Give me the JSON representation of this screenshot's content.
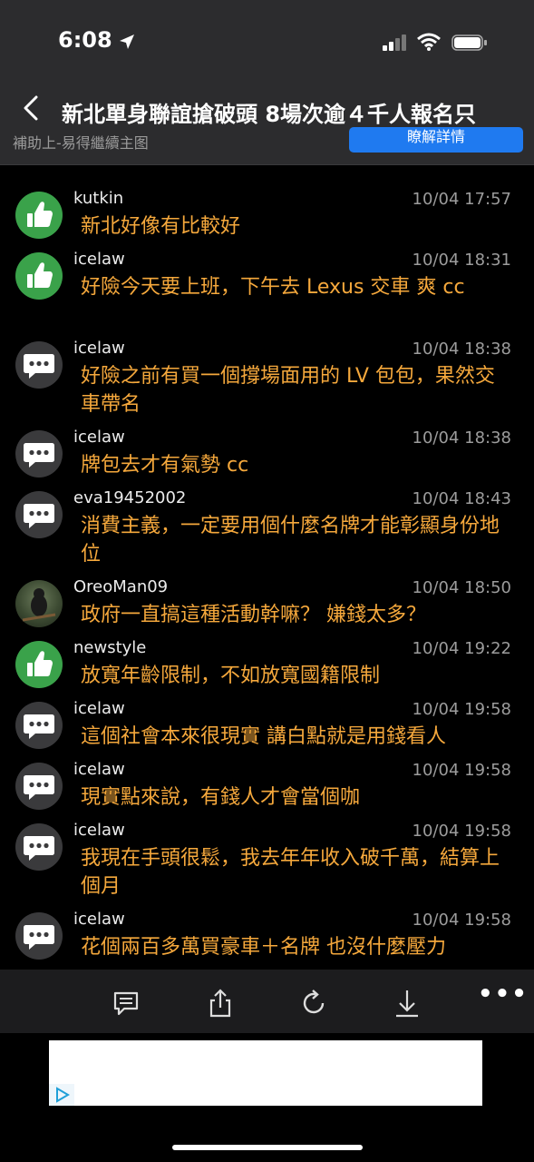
{
  "status_bar": {
    "time": "6:08"
  },
  "nav": {
    "title": "新北單身聯誼搶破頭 8場次逾４千人報名只",
    "partial_text": "補助上-易得繼續主图",
    "ad_button_label": "瞭解詳情"
  },
  "comments": [
    {
      "user": "kutkin",
      "timestamp": "10/04 17:57",
      "text": "新北好像有比較好",
      "avatar": "like"
    },
    {
      "user": "icelaw",
      "timestamp": "10/04 18:31",
      "text": "好險今天要上班，下午去 Lexus 交車 爽 cc",
      "avatar": "like"
    },
    {
      "user": "icelaw",
      "timestamp": "10/04 18:38",
      "text": "好險之前有買一個撐場面用的 LV 包包，果然交車帶名",
      "avatar": "chat"
    },
    {
      "user": "icelaw",
      "timestamp": "10/04 18:38",
      "text": "牌包去才有氣勢 cc",
      "avatar": "chat"
    },
    {
      "user": "eva19452002",
      "timestamp": "10/04 18:43",
      "text": "消費主義，一定要用個什麼名牌才能彰顯身份地位",
      "avatar": "chat"
    },
    {
      "user": "OreoMan09",
      "timestamp": "10/04 18:50",
      "text": "政府一直搞這種活動幹嘛？ 嫌錢太多？",
      "avatar": "photo"
    },
    {
      "user": "newstyle",
      "timestamp": "10/04 19:22",
      "text": "放寬年齡限制，不如放寬國籍限制",
      "avatar": "like"
    },
    {
      "user": "icelaw",
      "timestamp": "10/04 19:58",
      "text": "這個社會本來很現實 講白點就是用錢看人",
      "avatar": "chat"
    },
    {
      "user": "icelaw",
      "timestamp": "10/04 19:58",
      "text": "現實點來說，有錢人才會當個咖",
      "avatar": "chat"
    },
    {
      "user": "icelaw",
      "timestamp": "10/04 19:58",
      "text": "我現在手頭很鬆，我去年年收入破千萬，結算上個月",
      "avatar": "chat"
    },
    {
      "user": "icelaw",
      "timestamp": "10/04 19:58",
      "text": "花個兩百多萬買豪車＋名牌 也沒什麼壓力",
      "avatar": "chat"
    }
  ],
  "toolbar": {
    "icons": [
      "comment-icon",
      "share-icon",
      "refresh-icon",
      "download-icon",
      "more-icon"
    ],
    "more_label": "•••"
  },
  "colors": {
    "comment_text": "#f5a83c",
    "like_avatar": "#3aa24a",
    "chat_avatar": "#3a3a3c",
    "ad_button": "#1f7af0"
  }
}
